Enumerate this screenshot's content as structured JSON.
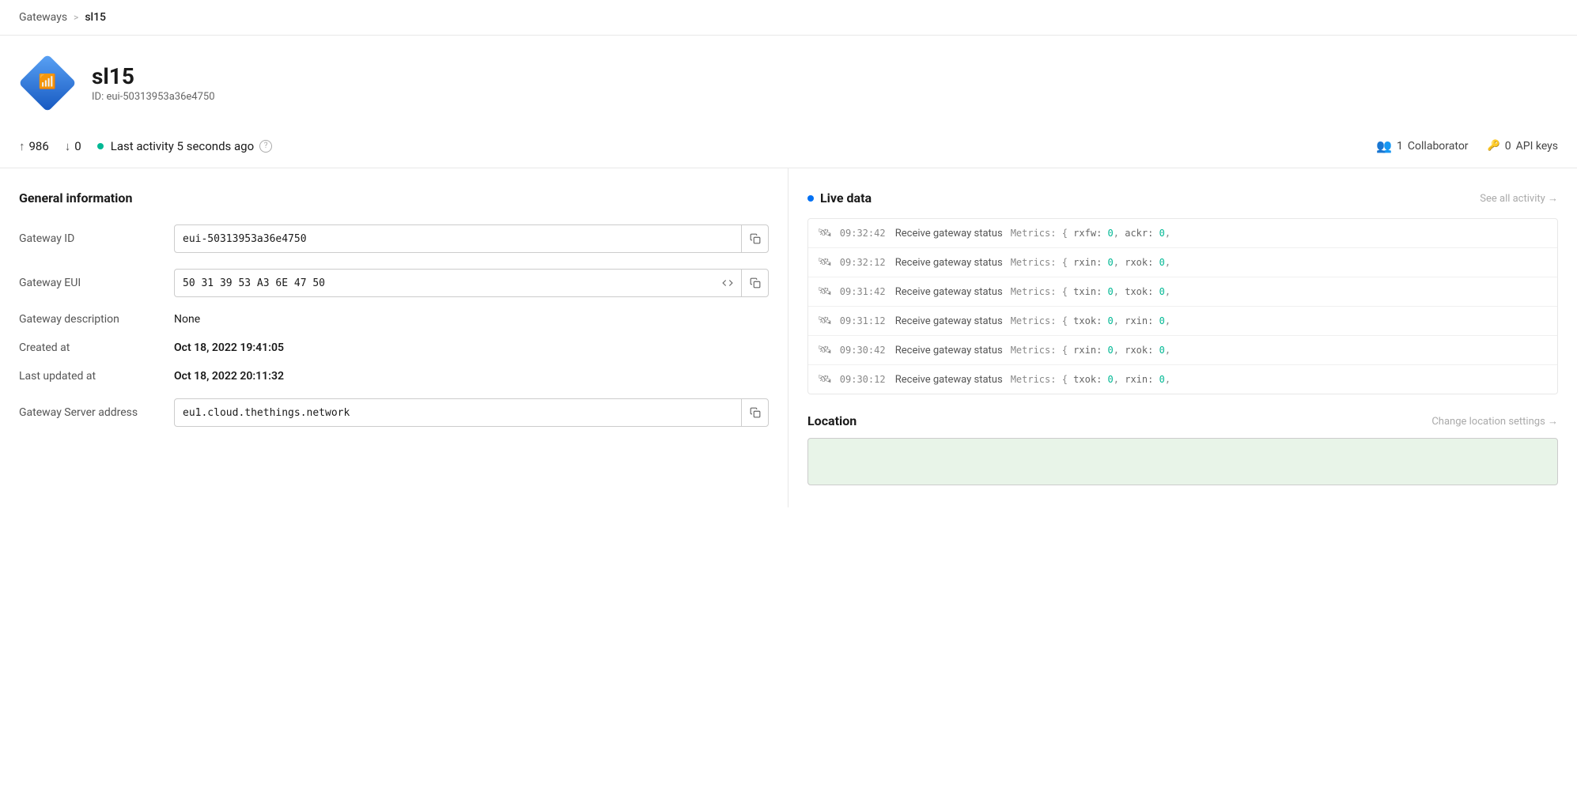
{
  "breadcrumb": {
    "parent": "Gateways",
    "separator": ">",
    "current": "sl15"
  },
  "gateway": {
    "name": "sl15",
    "id_label": "ID: eui-50313953a36e4750",
    "icon_alt": "gateway-icon"
  },
  "stats": {
    "up_arrow": "↑",
    "up_value": "986",
    "down_arrow": "↓",
    "down_value": "0",
    "last_activity": "Last activity 5 seconds ago",
    "help": "?",
    "collaborators_icon": "👥",
    "collaborators_count": "1",
    "collaborators_label": "Collaborator",
    "api_keys_icon": "🔑",
    "api_keys_count": "0",
    "api_keys_label": "API keys"
  },
  "general_info": {
    "section_title": "General information",
    "rows": [
      {
        "label": "Gateway ID",
        "value": "eui-50313953a36e4750",
        "type": "input-copy"
      },
      {
        "label": "Gateway EUI",
        "value": "50 31 39 53 A3 6E 47 50",
        "type": "input-code-copy"
      },
      {
        "label": "Gateway description",
        "value": "None",
        "type": "text"
      },
      {
        "label": "Created at",
        "value": "Oct 18, 2022 19:41:05",
        "type": "bold-text"
      },
      {
        "label": "Last updated at",
        "value": "Oct 18, 2022 20:11:32",
        "type": "bold-text"
      },
      {
        "label": "Gateway Server address",
        "value": "eu1.cloud.thethings.network",
        "type": "input-copy"
      }
    ]
  },
  "live_data": {
    "section_title": "Live data",
    "see_all_label": "See all activity →",
    "entries": [
      {
        "time": "09:32:42",
        "description": "Receive gateway status",
        "metrics": "Metrics: { rxfw: 0, ackr: 0,"
      },
      {
        "time": "09:32:12",
        "description": "Receive gateway status",
        "metrics": "Metrics: { rxin: 0, rxok: 0,"
      },
      {
        "time": "09:31:42",
        "description": "Receive gateway status",
        "metrics": "Metrics: { txin: 0, txok: 0,"
      },
      {
        "time": "09:31:12",
        "description": "Receive gateway status",
        "metrics": "Metrics: { txok: 0, rxin: 0,"
      },
      {
        "time": "09:30:42",
        "description": "Receive gateway status",
        "metrics": "Metrics: { rxin: 0, rxok: 0,"
      },
      {
        "time": "09:30:12",
        "description": "Receive gateway status",
        "metrics": "Metrics: { txok: 0, rxin: 0,"
      }
    ]
  },
  "location": {
    "title": "Location",
    "change_link": "Change location settings →"
  },
  "colors": {
    "live_dot": "#0070f3",
    "activity_dot": "#00b894",
    "diamond_from": "#5ba3f5",
    "diamond_to": "#1557c0"
  }
}
